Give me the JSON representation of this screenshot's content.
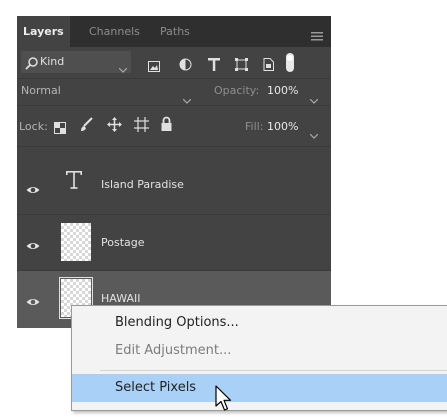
{
  "panel": {
    "tabs": [
      {
        "label": "Layers",
        "active": true
      },
      {
        "label": "Channels",
        "active": false
      },
      {
        "label": "Paths",
        "active": false
      }
    ],
    "menu_icon": "hamburger-menu-icon"
  },
  "filter_row": {
    "kind_label": "Kind",
    "icons": [
      "pixel-filter-icon",
      "adjustment-filter-icon",
      "type-filter-icon",
      "shape-filter-icon",
      "smart-object-filter-icon",
      "filter-toggle-icon"
    ]
  },
  "blend_row": {
    "blend_mode": "Normal",
    "opacity_label": "Opacity:",
    "opacity_value": "100%"
  },
  "lock_row": {
    "lock_label": "Lock:",
    "icons": [
      "lock-transparent-icon",
      "lock-image-icon",
      "lock-position-icon",
      "lock-artboard-icon",
      "lock-all-icon"
    ],
    "fill_label": "Fill:",
    "fill_value": "100%"
  },
  "layers": [
    {
      "name": "Island Paradise",
      "kind": "type",
      "visible": true
    },
    {
      "name": "Postage",
      "kind": "pixel",
      "visible": true
    },
    {
      "name": "HAWAII",
      "kind": "pixel",
      "visible": true,
      "selected": true
    }
  ],
  "context_menu": {
    "items": [
      {
        "label": "Blending Options...",
        "enabled": true
      },
      {
        "label": "Edit Adjustment...",
        "enabled": false
      },
      {
        "label": "Select Pixels",
        "enabled": true,
        "highlighted": true
      }
    ]
  },
  "colors": {
    "panel_bg": "#434343",
    "tab_bar_bg": "#2f2f2f",
    "selected_layer_bg": "#5a5a5a",
    "menu_highlight": "#a9d1f7"
  }
}
